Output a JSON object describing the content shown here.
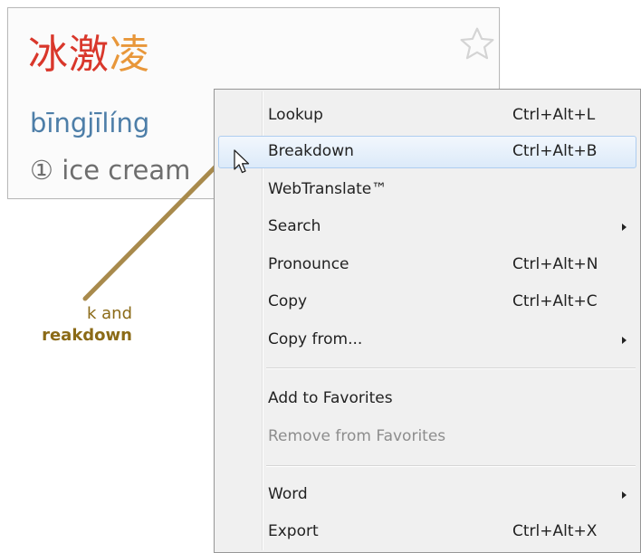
{
  "entry": {
    "characters": [
      {
        "char": "冰",
        "color": "#d9372b"
      },
      {
        "char": "激",
        "color": "#d9372b"
      },
      {
        "char": "凌",
        "color": "#e8973a"
      }
    ],
    "pinyin": "bīngjīlíng",
    "definition": "① ice cream",
    "favorite_icon": "star-outline-icon"
  },
  "annotation": {
    "line1": "k and",
    "line2": "reakdown",
    "color": "#8b6a17"
  },
  "menu": {
    "items": [
      {
        "label": "Lookup",
        "shortcut": "Ctrl+Alt+L",
        "submenu": false,
        "state": "normal"
      },
      {
        "label": "Breakdown",
        "shortcut": "Ctrl+Alt+B",
        "submenu": false,
        "state": "highlighted"
      },
      {
        "label": "WebTranslate™",
        "shortcut": "",
        "submenu": false,
        "state": "normal"
      },
      {
        "label": "Search",
        "shortcut": "",
        "submenu": true,
        "state": "normal"
      },
      {
        "label": "Pronounce",
        "shortcut": "Ctrl+Alt+N",
        "submenu": false,
        "state": "normal"
      },
      {
        "label": "Copy",
        "shortcut": "Ctrl+Alt+C",
        "submenu": false,
        "state": "normal"
      },
      {
        "label": "Copy from...",
        "shortcut": "",
        "submenu": true,
        "state": "normal"
      },
      {
        "label": "Add to Favorites",
        "shortcut": "",
        "submenu": false,
        "state": "normal"
      },
      {
        "label": "Remove from Favorites",
        "shortcut": "",
        "submenu": false,
        "state": "disabled"
      },
      {
        "label": "Word",
        "shortcut": "",
        "submenu": true,
        "state": "normal"
      },
      {
        "label": "Export",
        "shortcut": "Ctrl+Alt+X",
        "submenu": false,
        "state": "normal"
      }
    ]
  },
  "cursor_icon": "mouse-pointer-icon"
}
